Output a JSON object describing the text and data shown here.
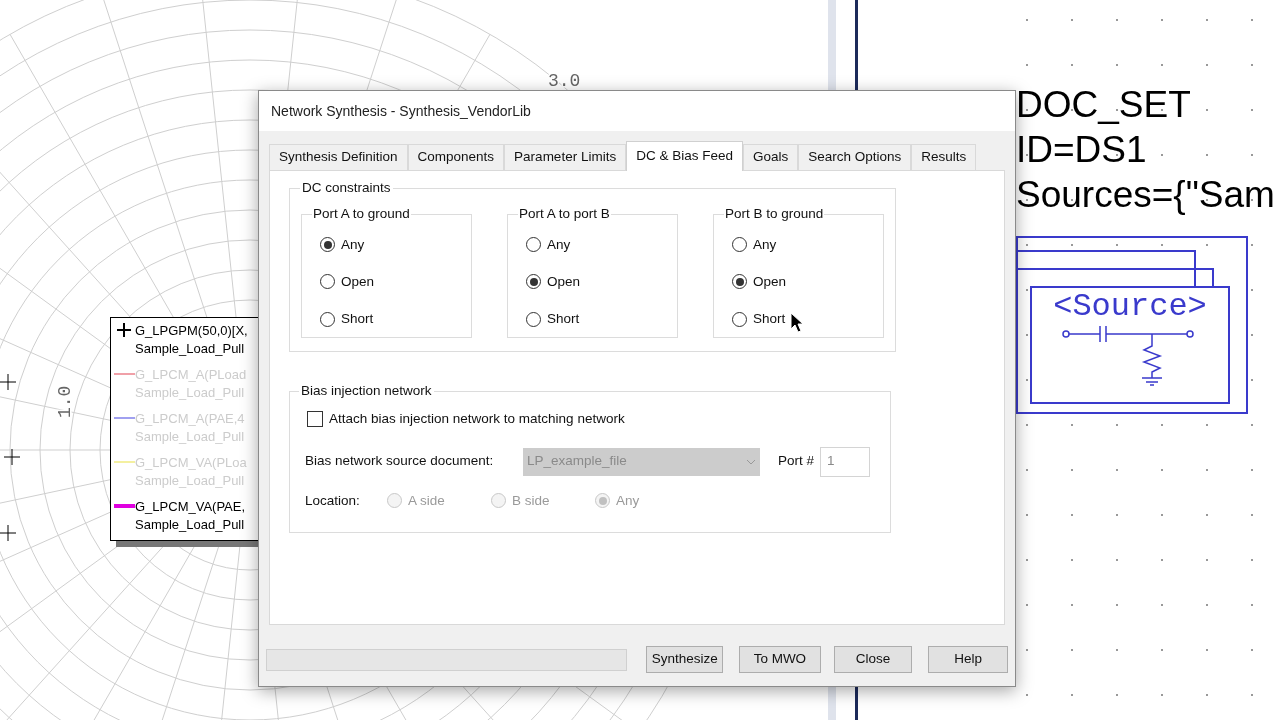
{
  "background": {
    "smith_labels": [
      "3.0",
      "1.0"
    ],
    "legend": [
      {
        "kind": "marker",
        "color": "#000000",
        "dimmed": false,
        "lines": [
          "G_LPGPM(50,0)[X,",
          "Sample_Load_Pull"
        ]
      },
      {
        "kind": "line",
        "color": "#f0a0a8",
        "dimmed": true,
        "lines": [
          "G_LPCM_A(PLoad",
          "Sample_Load_Pull"
        ]
      },
      {
        "kind": "line",
        "color": "#a0a0f0",
        "dimmed": true,
        "lines": [
          "G_LPCM_A(PAE,4",
          "Sample_Load_Pull"
        ]
      },
      {
        "kind": "line",
        "color": "#f4f0a0",
        "dimmed": true,
        "lines": [
          "G_LPCM_VA(PLoa",
          "Sample_Load_Pull"
        ]
      },
      {
        "kind": "line",
        "color": "#e000e0",
        "dimmed": false,
        "lines": [
          "G_LPCM_VA(PAE,",
          "Sample_Load_Pull"
        ]
      }
    ],
    "schematic": {
      "lines": [
        "DOC_SET",
        "ID=DS1",
        "Sources={\"Sam"
      ],
      "symbol_label": "<Source>"
    }
  },
  "dialog": {
    "title": "Network Synthesis - Synthesis_VendorLib",
    "tabs": [
      {
        "label": "Synthesis Definition",
        "selected": false
      },
      {
        "label": "Components",
        "selected": false
      },
      {
        "label": "Parameter Limits",
        "selected": false
      },
      {
        "label": "DC & Bias Feed",
        "selected": true
      },
      {
        "label": "Goals",
        "selected": false
      },
      {
        "label": "Search Options",
        "selected": false
      },
      {
        "label": "Results",
        "selected": false
      }
    ],
    "dc_constraints": {
      "title": "DC constraints",
      "groups": [
        {
          "title": "Port A to ground",
          "options": [
            {
              "label": "Any",
              "selected": true
            },
            {
              "label": "Open",
              "selected": false
            },
            {
              "label": "Short",
              "selected": false
            }
          ]
        },
        {
          "title": "Port A to port B",
          "options": [
            {
              "label": "Any",
              "selected": false
            },
            {
              "label": "Open",
              "selected": true
            },
            {
              "label": "Short",
              "selected": false
            }
          ]
        },
        {
          "title": "Port B to ground",
          "options": [
            {
              "label": "Any",
              "selected": false
            },
            {
              "label": "Open",
              "selected": true
            },
            {
              "label": "Short",
              "selected": false
            }
          ]
        }
      ]
    },
    "bias": {
      "title": "Bias injection network",
      "attach": {
        "label": "Attach bias injection network to matching network",
        "checked": false
      },
      "source": {
        "label": "Bias network source document:",
        "value": "LP_example_file",
        "disabled": true
      },
      "port": {
        "label": "Port #",
        "value": "1",
        "disabled": true
      },
      "location": {
        "label": "Location:",
        "options": [
          {
            "label": "A side",
            "selected": false,
            "disabled": true
          },
          {
            "label": "B side",
            "selected": false,
            "disabled": true
          },
          {
            "label": "Any",
            "selected": true,
            "disabled": true
          }
        ]
      }
    },
    "progress": {
      "level": 0
    },
    "buttons": [
      "Synthesize",
      "To MWO",
      "Close",
      "Help"
    ]
  }
}
